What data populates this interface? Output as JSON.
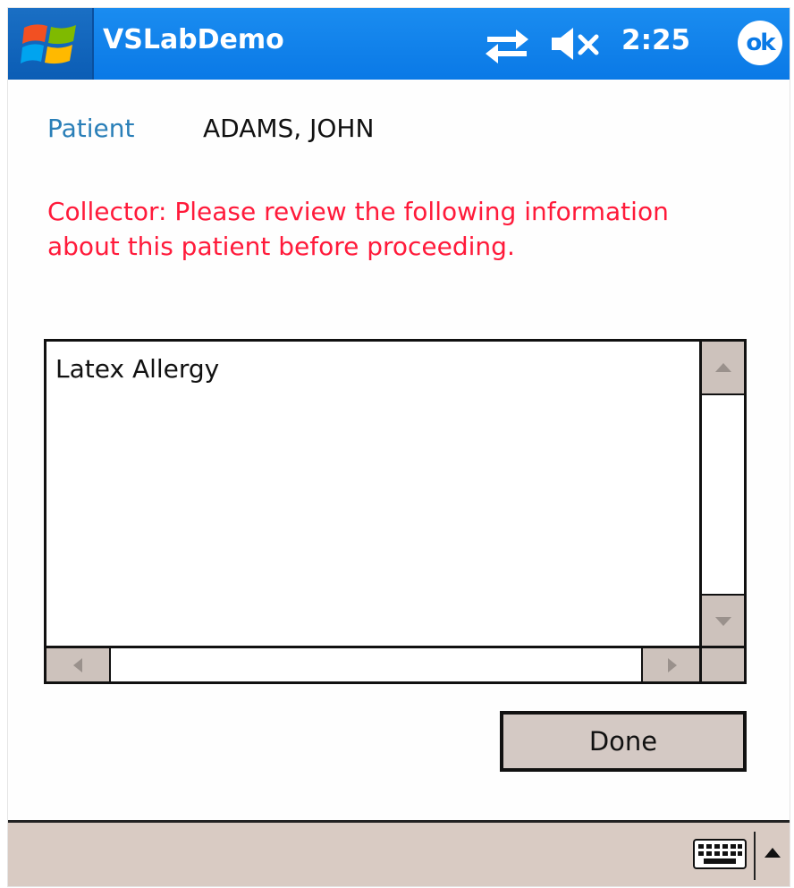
{
  "titlebar": {
    "app_title": "VSLabDemo",
    "time": "2:25",
    "ok_label": "ok"
  },
  "patient": {
    "label": "Patient",
    "name": "ADAMS, JOHN"
  },
  "message": "Collector: Please review the following information about this patient before proceeding.",
  "info_list": {
    "items": [
      "Latex Allergy"
    ]
  },
  "buttons": {
    "done": "Done"
  },
  "colors": {
    "titlebar": "#0a79e6",
    "warning_text": "#ff1a3a",
    "label_text": "#2a7fb8",
    "button_face": "#d4c9c4"
  }
}
